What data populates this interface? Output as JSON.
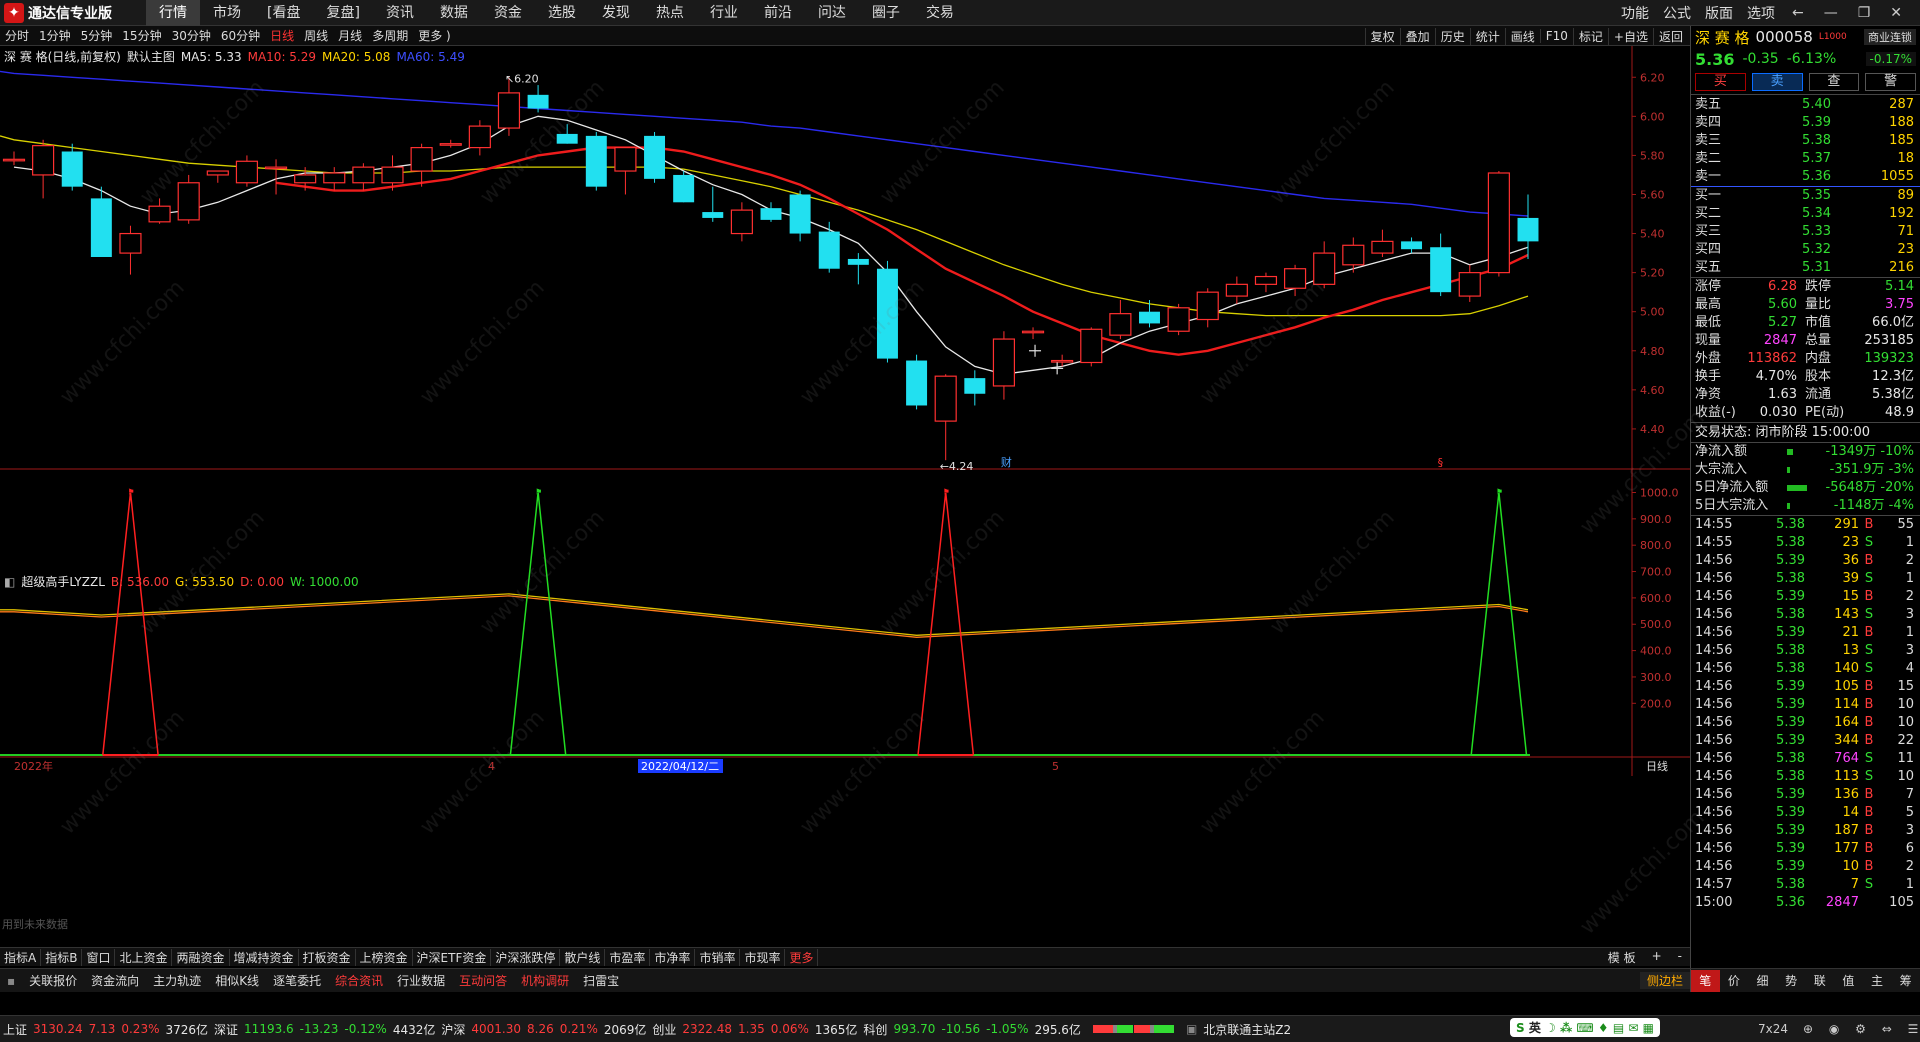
{
  "app": {
    "title": "通达信专业版"
  },
  "menu": [
    "行情",
    "市场",
    "[看盘",
    "复盘]",
    "资讯",
    "数据",
    "资金",
    "选股",
    "发现",
    "热点",
    "行业",
    "前沿",
    "问达",
    "圈子",
    "交易"
  ],
  "menu_active": 0,
  "menu_right": [
    "功能",
    "公式",
    "版面",
    "选项"
  ],
  "periods": [
    "分时",
    "1分钟",
    "5分钟",
    "15分钟",
    "30分钟",
    "60分钟",
    "日线",
    "周线",
    "月线",
    "多周期",
    "更多 )"
  ],
  "period_selected": 6,
  "chart_tools": [
    "复权",
    "叠加",
    "历史",
    "统计",
    "画线",
    "F10",
    "标记",
    "+自选",
    "返回"
  ],
  "main_legend": {
    "name": "深 赛 格(日线,前复权)",
    "indicator": "默认主图",
    "ma5": "MA5: 5.33",
    "ma10": "MA10: 5.29",
    "ma20": "MA20: 5.08",
    "ma60": "MA60: 5.49"
  },
  "sub_legend": {
    "name": "超级高手LYZZL",
    "b": "B: 536.00",
    "g": "G: 553.50",
    "d": "D: 0.00",
    "w": "W: 1000.00"
  },
  "annotations": {
    "high": "6.20",
    "low": "4.24",
    "fin": "财",
    "s": "§",
    "note": "用到未来数据"
  },
  "x_axis": {
    "start": "2022年",
    "m4": "4",
    "cursor": "2022/04/12/二",
    "m5": "5",
    "period": "日线"
  },
  "chart_data": {
    "type": "candlestick",
    "y_ticks_main": [
      "6.20",
      "6.00",
      "5.80",
      "5.60",
      "5.40",
      "5.20",
      "5.00",
      "4.80",
      "4.60",
      "4.40"
    ],
    "y_ticks_sub": [
      "1000.0",
      "900.0",
      "800.0",
      "700.0",
      "600.0",
      "500.0",
      "400.0",
      "300.0",
      "200.0"
    ],
    "candles": [
      {
        "o": 5.78,
        "h": 5.82,
        "l": 5.75,
        "c": 5.78
      },
      {
        "o": 5.7,
        "h": 5.88,
        "l": 5.58,
        "c": 5.85
      },
      {
        "o": 5.82,
        "h": 5.86,
        "l": 5.62,
        "c": 5.64
      },
      {
        "o": 5.58,
        "h": 5.64,
        "l": 5.28,
        "c": 5.28
      },
      {
        "o": 5.3,
        "h": 5.44,
        "l": 5.19,
        "c": 5.4
      },
      {
        "o": 5.46,
        "h": 5.58,
        "l": 5.45,
        "c": 5.54
      },
      {
        "o": 5.47,
        "h": 5.7,
        "l": 5.45,
        "c": 5.66
      },
      {
        "o": 5.7,
        "h": 5.72,
        "l": 5.66,
        "c": 5.72
      },
      {
        "o": 5.66,
        "h": 5.8,
        "l": 5.64,
        "c": 5.77
      },
      {
        "o": 5.74,
        "h": 5.78,
        "l": 5.6,
        "c": 5.74
      },
      {
        "o": 5.66,
        "h": 5.74,
        "l": 5.62,
        "c": 5.7
      },
      {
        "o": 5.66,
        "h": 5.74,
        "l": 5.62,
        "c": 5.71
      },
      {
        "o": 5.66,
        "h": 5.76,
        "l": 5.62,
        "c": 5.74
      },
      {
        "o": 5.66,
        "h": 5.8,
        "l": 5.62,
        "c": 5.74
      },
      {
        "o": 5.72,
        "h": 5.86,
        "l": 5.64,
        "c": 5.84
      },
      {
        "o": 5.86,
        "h": 5.88,
        "l": 5.84,
        "c": 5.86
      },
      {
        "o": 5.84,
        "h": 5.98,
        "l": 5.8,
        "c": 5.95
      },
      {
        "o": 5.94,
        "h": 6.2,
        "l": 5.9,
        "c": 6.12
      },
      {
        "o": 6.11,
        "h": 6.16,
        "l": 6.02,
        "c": 6.04
      },
      {
        "o": 5.91,
        "h": 5.96,
        "l": 5.86,
        "c": 5.86
      },
      {
        "o": 5.9,
        "h": 5.92,
        "l": 5.62,
        "c": 5.64
      },
      {
        "o": 5.72,
        "h": 5.84,
        "l": 5.6,
        "c": 5.84
      },
      {
        "o": 5.9,
        "h": 5.92,
        "l": 5.66,
        "c": 5.68
      },
      {
        "o": 5.7,
        "h": 5.72,
        "l": 5.56,
        "c": 5.56
      },
      {
        "o": 5.51,
        "h": 5.64,
        "l": 5.46,
        "c": 5.48
      },
      {
        "o": 5.4,
        "h": 5.56,
        "l": 5.36,
        "c": 5.52
      },
      {
        "o": 5.53,
        "h": 5.56,
        "l": 5.46,
        "c": 5.47
      },
      {
        "o": 5.6,
        "h": 5.62,
        "l": 5.36,
        "c": 5.4
      },
      {
        "o": 5.41,
        "h": 5.46,
        "l": 5.2,
        "c": 5.22
      },
      {
        "o": 5.27,
        "h": 5.3,
        "l": 5.14,
        "c": 5.24
      },
      {
        "o": 5.22,
        "h": 5.26,
        "l": 4.74,
        "c": 4.76
      },
      {
        "o": 4.75,
        "h": 4.78,
        "l": 4.5,
        "c": 4.52
      },
      {
        "o": 4.44,
        "h": 4.68,
        "l": 4.24,
        "c": 4.67
      },
      {
        "o": 4.66,
        "h": 4.7,
        "l": 4.52,
        "c": 4.58
      },
      {
        "o": 4.62,
        "h": 4.9,
        "l": 4.55,
        "c": 4.86
      },
      {
        "o": 4.9,
        "h": 4.92,
        "l": 4.86,
        "c": 4.9
      },
      {
        "o": 4.75,
        "h": 4.78,
        "l": 4.72,
        "c": 4.75
      },
      {
        "o": 4.74,
        "h": 4.92,
        "l": 4.72,
        "c": 4.91
      },
      {
        "o": 4.88,
        "h": 5.06,
        "l": 4.86,
        "c": 4.99
      },
      {
        "o": 5.0,
        "h": 5.06,
        "l": 4.92,
        "c": 4.94
      },
      {
        "o": 4.9,
        "h": 5.04,
        "l": 4.88,
        "c": 5.02
      },
      {
        "o": 4.96,
        "h": 5.12,
        "l": 4.92,
        "c": 5.1
      },
      {
        "o": 5.08,
        "h": 5.18,
        "l": 5.04,
        "c": 5.14
      },
      {
        "o": 5.14,
        "h": 5.2,
        "l": 5.1,
        "c": 5.18
      },
      {
        "o": 5.12,
        "h": 5.24,
        "l": 5.08,
        "c": 5.22
      },
      {
        "o": 5.14,
        "h": 5.36,
        "l": 5.12,
        "c": 5.3
      },
      {
        "o": 5.24,
        "h": 5.38,
        "l": 5.2,
        "c": 5.34
      },
      {
        "o": 5.3,
        "h": 5.42,
        "l": 5.28,
        "c": 5.36
      },
      {
        "o": 5.36,
        "h": 5.38,
        "l": 5.3,
        "c": 5.32
      },
      {
        "o": 5.33,
        "h": 5.4,
        "l": 5.08,
        "c": 5.1
      },
      {
        "o": 5.08,
        "h": 5.24,
        "l": 5.05,
        "c": 5.2
      },
      {
        "o": 5.2,
        "h": 5.72,
        "l": 5.18,
        "c": 5.71
      },
      {
        "o": 5.48,
        "h": 5.6,
        "l": 5.27,
        "c": 5.36
      }
    ],
    "ma5": [
      5.74,
      5.72,
      5.68,
      5.62,
      5.54,
      5.5,
      5.52,
      5.56,
      5.62,
      5.68,
      5.71,
      5.71,
      5.72,
      5.74,
      5.76,
      5.8,
      5.86,
      5.95,
      6.0,
      5.98,
      5.93,
      5.88,
      5.8,
      5.72,
      5.65,
      5.6,
      5.52,
      5.48,
      5.42,
      5.35,
      5.2,
      5.0,
      4.82,
      4.72,
      4.68,
      4.7,
      4.72,
      4.76,
      4.84,
      4.9,
      4.94,
      4.98,
      5.04,
      5.08,
      5.12,
      5.18,
      5.22,
      5.26,
      5.3,
      5.3,
      5.24,
      5.28,
      5.33
    ],
    "ma10": [
      null,
      null,
      null,
      null,
      null,
      null,
      null,
      null,
      null,
      5.66,
      5.64,
      5.62,
      5.62,
      5.64,
      5.66,
      5.68,
      5.72,
      5.76,
      5.8,
      5.82,
      5.84,
      5.84,
      5.84,
      5.82,
      5.78,
      5.74,
      5.7,
      5.65,
      5.58,
      5.5,
      5.42,
      5.32,
      5.22,
      5.15,
      5.08,
      5.0,
      4.94,
      4.88,
      4.84,
      4.8,
      4.78,
      4.8,
      4.84,
      4.88,
      4.92,
      4.97,
      5.01,
      5.06,
      5.1,
      5.14,
      5.18,
      5.22,
      5.29
    ],
    "ma20": [
      5.88,
      5.86,
      5.84,
      5.82,
      5.8,
      5.78,
      5.76,
      5.75,
      5.74,
      5.73,
      5.72,
      5.71,
      5.71,
      5.71,
      5.72,
      5.72,
      5.73,
      5.74,
      5.74,
      5.74,
      5.74,
      5.74,
      5.74,
      5.73,
      5.7,
      5.67,
      5.64,
      5.6,
      5.56,
      5.52,
      5.47,
      5.42,
      5.36,
      5.3,
      5.24,
      5.19,
      5.14,
      5.1,
      5.07,
      5.04,
      5.02,
      5.0,
      4.99,
      4.98,
      4.98,
      4.98,
      4.98,
      4.98,
      4.98,
      4.98,
      4.99,
      5.03,
      5.08
    ],
    "ma60": [
      6.22,
      6.21,
      6.2,
      6.19,
      6.18,
      6.17,
      6.16,
      6.15,
      6.14,
      6.13,
      6.12,
      6.11,
      6.1,
      6.09,
      6.08,
      6.07,
      6.06,
      6.05,
      6.04,
      6.03,
      6.02,
      6.01,
      6.0,
      5.99,
      5.98,
      5.97,
      5.95,
      5.94,
      5.92,
      5.9,
      5.88,
      5.86,
      5.84,
      5.82,
      5.8,
      5.78,
      5.76,
      5.74,
      5.72,
      5.7,
      5.68,
      5.66,
      5.64,
      5.62,
      5.6,
      5.58,
      5.57,
      5.56,
      5.55,
      5.53,
      5.51,
      5.5,
      5.49
    ],
    "indicator": {
      "b_line": [
        {
          "i": 0,
          "v": 555
        },
        {
          "i": 3,
          "v": 535
        },
        {
          "i": 17,
          "v": 615
        },
        {
          "i": 31,
          "v": 458
        },
        {
          "i": 51,
          "v": 575
        },
        {
          "i": 52,
          "v": 555
        }
      ],
      "spikes": [
        {
          "color": "red",
          "i": 4,
          "v": 1000
        },
        {
          "color": "green",
          "i": 18,
          "v": 1000
        },
        {
          "color": "red",
          "i": 32,
          "v": 1000
        },
        {
          "color": "green",
          "i": 51,
          "v": 1000
        }
      ]
    }
  },
  "quote": {
    "name": "深 赛 格",
    "code": "000058",
    "tag": "L1000",
    "badge": "商业连锁",
    "price": "5.36",
    "change": "-0.35",
    "pct": "-6.13%",
    "sector_pct": "-0.17%",
    "buttons": [
      "买",
      "卖",
      "查",
      "警"
    ],
    "asks": [
      {
        "label": "卖五",
        "price": "5.40",
        "vol": "287"
      },
      {
        "label": "卖四",
        "price": "5.39",
        "vol": "188"
      },
      {
        "label": "卖三",
        "price": "5.38",
        "vol": "185"
      },
      {
        "label": "卖二",
        "price": "5.37",
        "vol": "18"
      },
      {
        "label": "卖一",
        "price": "5.36",
        "vol": "1055"
      }
    ],
    "bids": [
      {
        "label": "买一",
        "price": "5.35",
        "vol": "89"
      },
      {
        "label": "买二",
        "price": "5.34",
        "vol": "192"
      },
      {
        "label": "买三",
        "price": "5.33",
        "vol": "71"
      },
      {
        "label": "买四",
        "price": "5.32",
        "vol": "23"
      },
      {
        "label": "买五",
        "price": "5.31",
        "vol": "216"
      }
    ],
    "stats": [
      {
        "l1": "涨停",
        "v1": "6.28",
        "c1": "red",
        "l2": "跌停",
        "v2": "5.14",
        "c2": "green"
      },
      {
        "l1": "最高",
        "v1": "5.60",
        "c1": "green",
        "l2": "量比",
        "v2": "3.75",
        "c2": "magenta"
      },
      {
        "l1": "最低",
        "v1": "5.27",
        "c1": "green",
        "l2": "市值",
        "v2": "66.0亿",
        "c2": "white"
      },
      {
        "l1": "现量",
        "v1": "2847",
        "c1": "magenta",
        "l2": "总量",
        "v2": "253185",
        "c2": "white"
      },
      {
        "l1": "外盘",
        "v1": "113862",
        "c1": "red",
        "l2": "内盘",
        "v2": "139323",
        "c2": "green"
      },
      {
        "l1": "换手",
        "v1": "4.70%",
        "c1": "white",
        "l2": "股本",
        "v2": "12.3亿",
        "c2": "white"
      },
      {
        "l1": "净资",
        "v1": "1.63",
        "c1": "white",
        "l2": "流通",
        "v2": "5.38亿",
        "c2": "white"
      },
      {
        "l1": "收益(-)",
        "v1": "0.030",
        "c1": "white",
        "l2": "PE(动)",
        "v2": "48.9",
        "c2": "white"
      }
    ],
    "trade_status": "交易状态: 闭市阶段 15:00:00",
    "flows": [
      {
        "label": "净流入额",
        "value": "-1349万 -10%"
      },
      {
        "label": "大宗流入",
        "value": "-351.9万  -3%"
      },
      {
        "label": "5日净流入额",
        "value": "-5648万 -20%"
      },
      {
        "label": "5日大宗流入",
        "value": "-1148万  -4%"
      }
    ],
    "ticks": [
      {
        "t": "14:55",
        "p": "5.38",
        "v": "291",
        "bs": "B",
        "n": "55"
      },
      {
        "t": "14:55",
        "p": "5.38",
        "v": "23",
        "bs": "S",
        "n": "1"
      },
      {
        "t": "14:56",
        "p": "5.39",
        "v": "36",
        "bs": "B",
        "n": "2"
      },
      {
        "t": "14:56",
        "p": "5.38",
        "v": "39",
        "bs": "S",
        "n": "1"
      },
      {
        "t": "14:56",
        "p": "5.39",
        "v": "15",
        "bs": "B",
        "n": "2"
      },
      {
        "t": "14:56",
        "p": "5.38",
        "v": "143",
        "bs": "S",
        "n": "3"
      },
      {
        "t": "14:56",
        "p": "5.39",
        "v": "21",
        "bs": "B",
        "n": "1"
      },
      {
        "t": "14:56",
        "p": "5.38",
        "v": "13",
        "bs": "S",
        "n": "3"
      },
      {
        "t": "14:56",
        "p": "5.38",
        "v": "140",
        "bs": "S",
        "n": "4"
      },
      {
        "t": "14:56",
        "p": "5.39",
        "v": "105",
        "bs": "B",
        "n": "15"
      },
      {
        "t": "14:56",
        "p": "5.39",
        "v": "114",
        "bs": "B",
        "n": "10"
      },
      {
        "t": "14:56",
        "p": "5.39",
        "v": "164",
        "bs": "B",
        "n": "10"
      },
      {
        "t": "14:56",
        "p": "5.39",
        "v": "344",
        "bs": "B",
        "n": "22"
      },
      {
        "t": "14:56",
        "p": "5.38",
        "v": "764",
        "bs": "S",
        "n": "11"
      },
      {
        "t": "14:56",
        "p": "5.38",
        "v": "113",
        "bs": "S",
        "n": "10"
      },
      {
        "t": "14:56",
        "p": "5.39",
        "v": "136",
        "bs": "B",
        "n": "7"
      },
      {
        "t": "14:56",
        "p": "5.39",
        "v": "14",
        "bs": "B",
        "n": "5"
      },
      {
        "t": "14:56",
        "p": "5.39",
        "v": "187",
        "bs": "B",
        "n": "3"
      },
      {
        "t": "14:56",
        "p": "5.39",
        "v": "177",
        "bs": "B",
        "n": "6"
      },
      {
        "t": "14:56",
        "p": "5.39",
        "v": "10",
        "bs": "B",
        "n": "2"
      },
      {
        "t": "14:57",
        "p": "5.38",
        "v": "7",
        "bs": "S",
        "n": "1"
      },
      {
        "t": "15:00",
        "p": "5.36",
        "v": "2847",
        "bs": "",
        "n": "105"
      }
    ],
    "bottom_tabs": [
      "笔",
      "价",
      "细",
      "势",
      "联",
      "值",
      "主",
      "筹"
    ]
  },
  "tabs_indicator": [
    "指标A",
    "指标B",
    "窗口",
    "北上资金",
    "两融资金",
    "增减持资金",
    "打板资金",
    "上榜资金",
    "沪深ETF资金",
    "沪深涨跌停",
    "散户线",
    "市盈率",
    "市净率",
    "市销率",
    "市现率",
    "更多"
  ],
  "tabs_indicator_right": [
    "模 板",
    "+",
    "-"
  ],
  "tabs_info": [
    "关联报价",
    "资金流向",
    "主力轨迹",
    "相似K线",
    "逐笔委托",
    "综合资讯",
    "行业数据",
    "互动问答",
    "机构调研",
    "扫雷宝"
  ],
  "tabs_info_right": "侧边栏",
  "status": {
    "sh_label": "上证",
    "sh_val": "3130.24",
    "sh_chg": "7.13",
    "sh_pct": "0.23%",
    "sh_amt": "3726亿",
    "sz_label": "深证",
    "sz_val": "11193.6",
    "sz_chg": "-13.23",
    "sz_pct": "-0.12%",
    "sz_amt": "4432亿",
    "hs_label": "沪深",
    "hs_val": "4001.30",
    "hs_chg": "8.26",
    "hs_pct": "0.21%",
    "hs_amt": "2069亿",
    "cy_label": "创业",
    "cy_val": "2322.48",
    "cy_chg": "1.35",
    "cy_pct": "0.06%",
    "cy_amt": "1365亿",
    "kc_label": "科创",
    "kc_val": "993.70",
    "kc_chg": "-10.56",
    "kc_pct": "-1.05%",
    "kc_amt": "295.6亿",
    "server": "北京联通主站Z2",
    "ime": "英",
    "clock": "7x24"
  },
  "watermark": "www.cfchi.com"
}
